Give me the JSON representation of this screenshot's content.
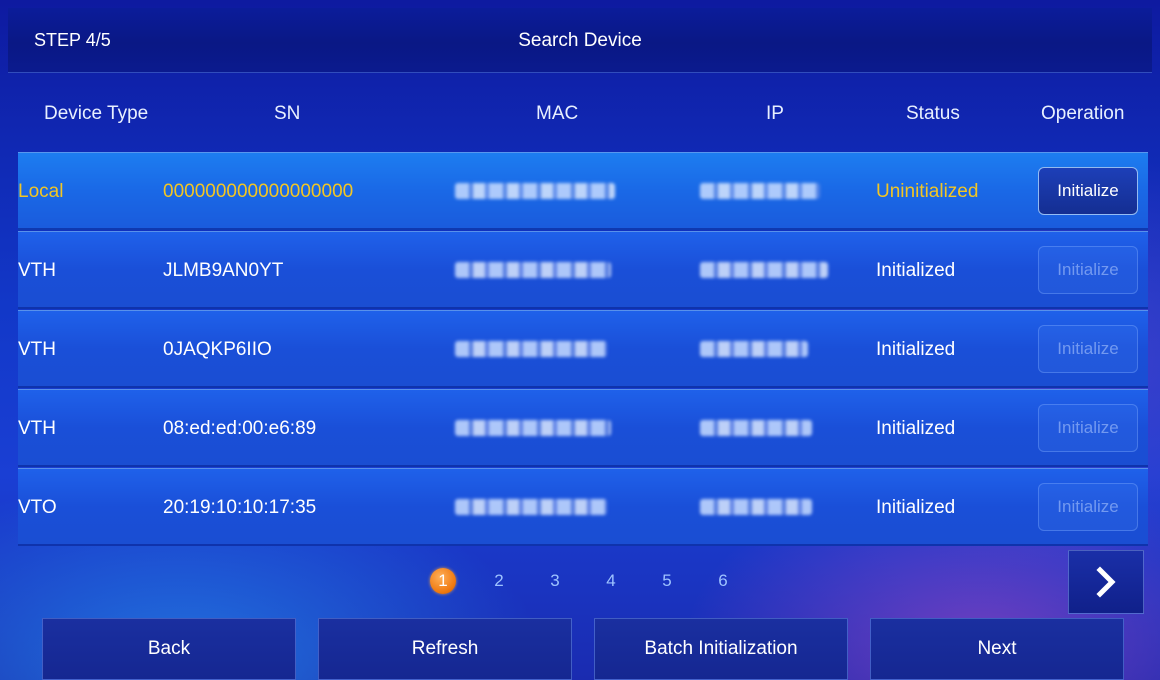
{
  "header": {
    "step": "STEP 4/5",
    "title": "Search Device"
  },
  "columns": {
    "device_type": "Device Type",
    "sn": "SN",
    "mac": "MAC",
    "ip": "IP",
    "status": "Status",
    "operation": "Operation"
  },
  "rows": [
    {
      "device_type": "Local",
      "sn": "000000000000000000",
      "status": "Uninitialized",
      "operation": "Initialize",
      "selected": true,
      "enabled": true
    },
    {
      "device_type": "VTH",
      "sn": "JLMB9AN0YT",
      "status": "Initialized",
      "operation": "Initialize",
      "selected": false,
      "enabled": false
    },
    {
      "device_type": "VTH",
      "sn": "0JAQKP6IIO",
      "status": "Initialized",
      "operation": "Initialize",
      "selected": false,
      "enabled": false
    },
    {
      "device_type": "VTH",
      "sn": "08:ed:ed:00:e6:89",
      "status": "Initialized",
      "operation": "Initialize",
      "selected": false,
      "enabled": false
    },
    {
      "device_type": "VTO",
      "sn": "20:19:10:10:17:35",
      "status": "Initialized",
      "operation": "Initialize",
      "selected": false,
      "enabled": false
    }
  ],
  "pagination": {
    "pages": [
      "1",
      "2",
      "3",
      "4",
      "5",
      "6"
    ],
    "current": "1"
  },
  "next_page_icon": "chevron-right-icon",
  "footer": {
    "back": "Back",
    "refresh": "Refresh",
    "batch": "Batch Initialization",
    "next": "Next"
  },
  "colors": {
    "highlight": "#f2c623",
    "active_page": "#f07a10"
  }
}
